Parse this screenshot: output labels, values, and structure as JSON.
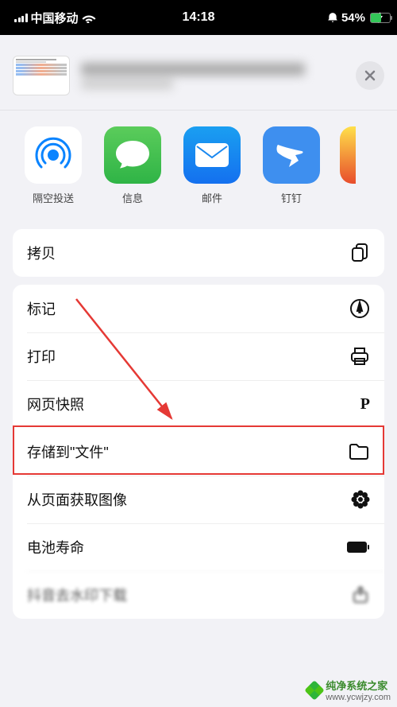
{
  "status": {
    "carrier": "中国移动",
    "time": "14:18",
    "battery": "54%"
  },
  "share_apps": [
    {
      "name": "airdrop",
      "label": "隔空投送"
    },
    {
      "name": "messages",
      "label": "信息"
    },
    {
      "name": "mail",
      "label": "邮件"
    },
    {
      "name": "dingtalk",
      "label": "钉钉"
    },
    {
      "name": "weibo",
      "label": ""
    }
  ],
  "actions": {
    "copy": "拷贝",
    "markup": "标记",
    "print": "打印",
    "websnap": "网页快照",
    "save_files": "存储到\"文件\"",
    "get_image": "从页面获取图像",
    "battery_life": "电池寿命",
    "douyin": "抖音去水印下载"
  },
  "watermark": {
    "brand": "纯净系统之家",
    "url": "www.ycwjzy.com"
  }
}
